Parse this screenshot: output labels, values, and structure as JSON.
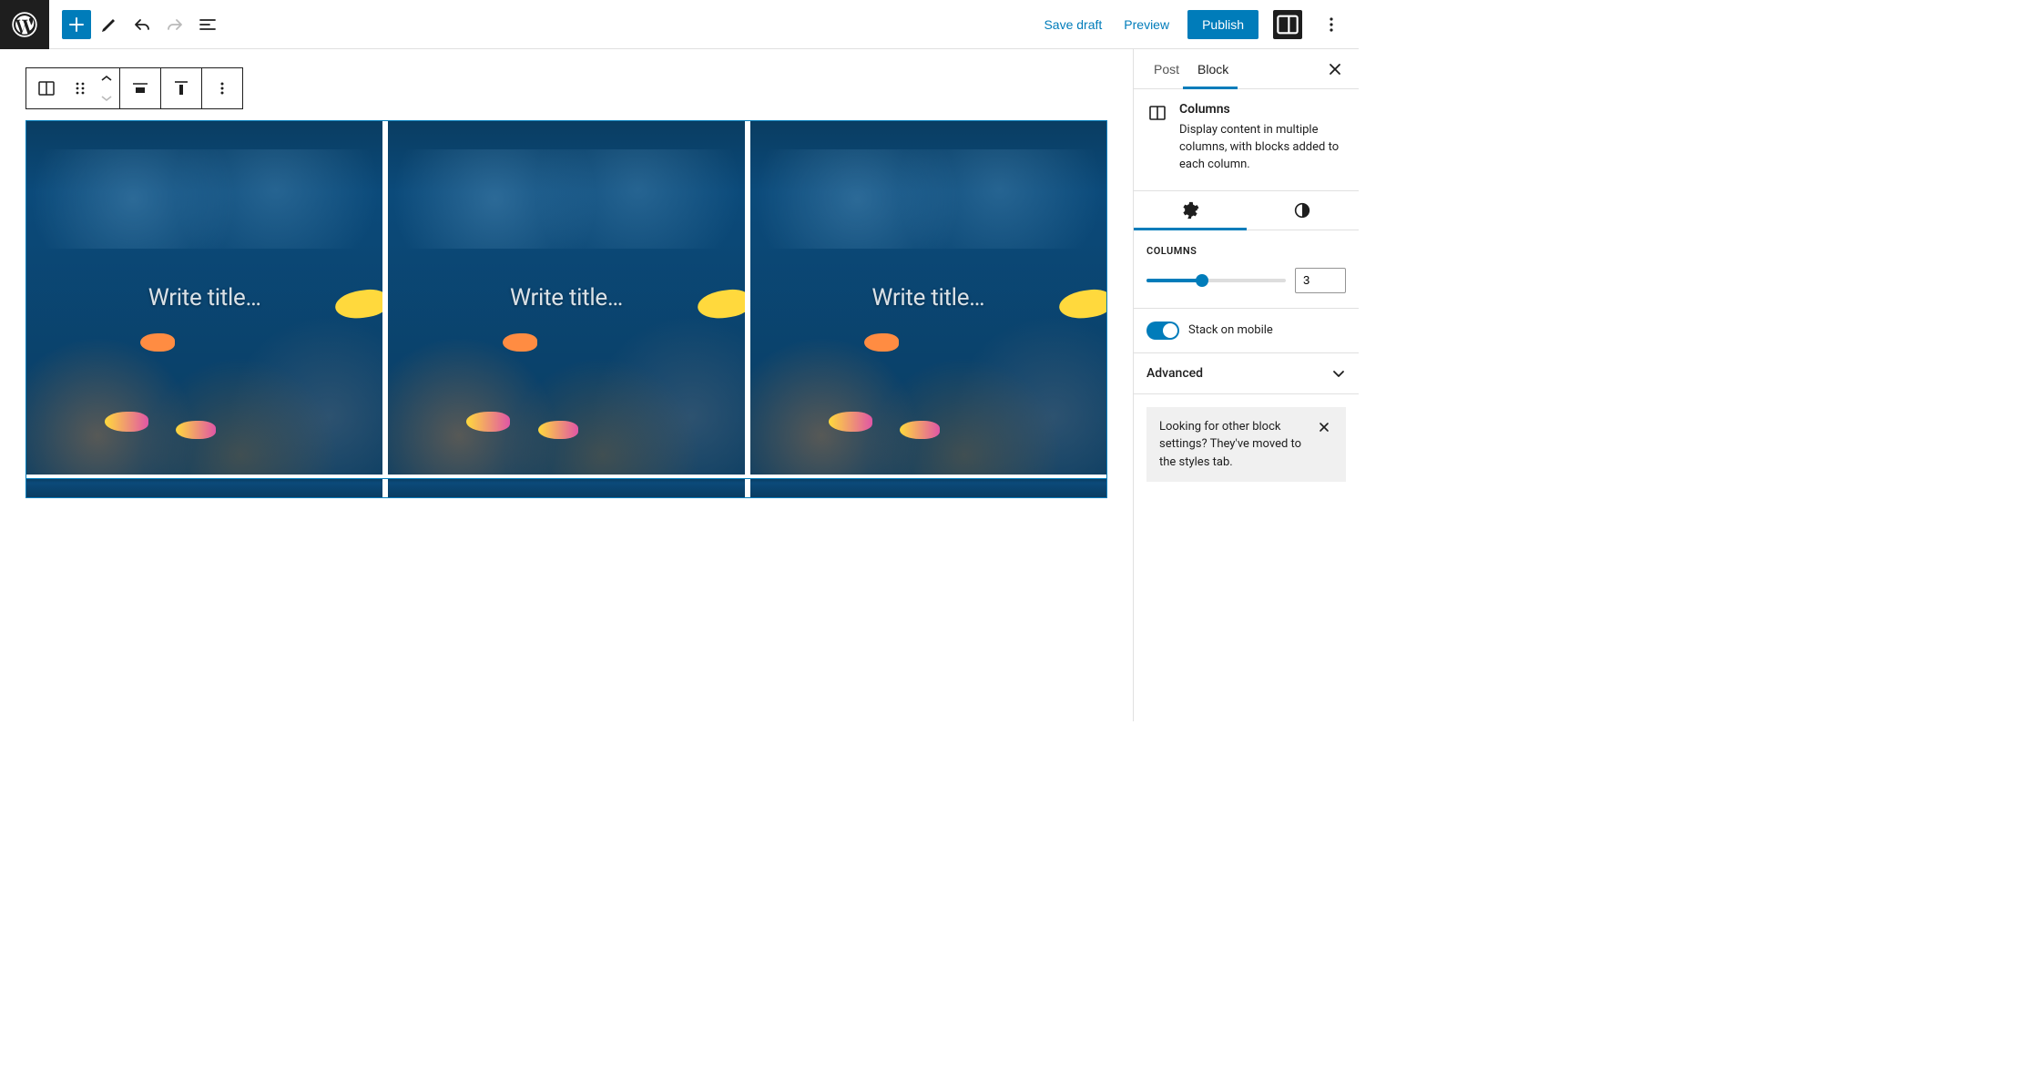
{
  "topbar": {
    "save_draft": "Save draft",
    "preview": "Preview",
    "publish": "Publish"
  },
  "sidebar": {
    "tabs": {
      "post": "Post",
      "block": "Block"
    },
    "block_card": {
      "title": "Columns",
      "description": "Display content in multiple columns, with blocks added to each column."
    },
    "columns_panel": {
      "label": "Columns",
      "value": "3"
    },
    "stack_toggle": {
      "label": "Stack on mobile"
    },
    "advanced": {
      "title": "Advanced"
    },
    "tip": {
      "text": "Looking for other block settings? They've moved to the styles tab."
    }
  },
  "editor": {
    "column_placeholder": "Write title…"
  }
}
